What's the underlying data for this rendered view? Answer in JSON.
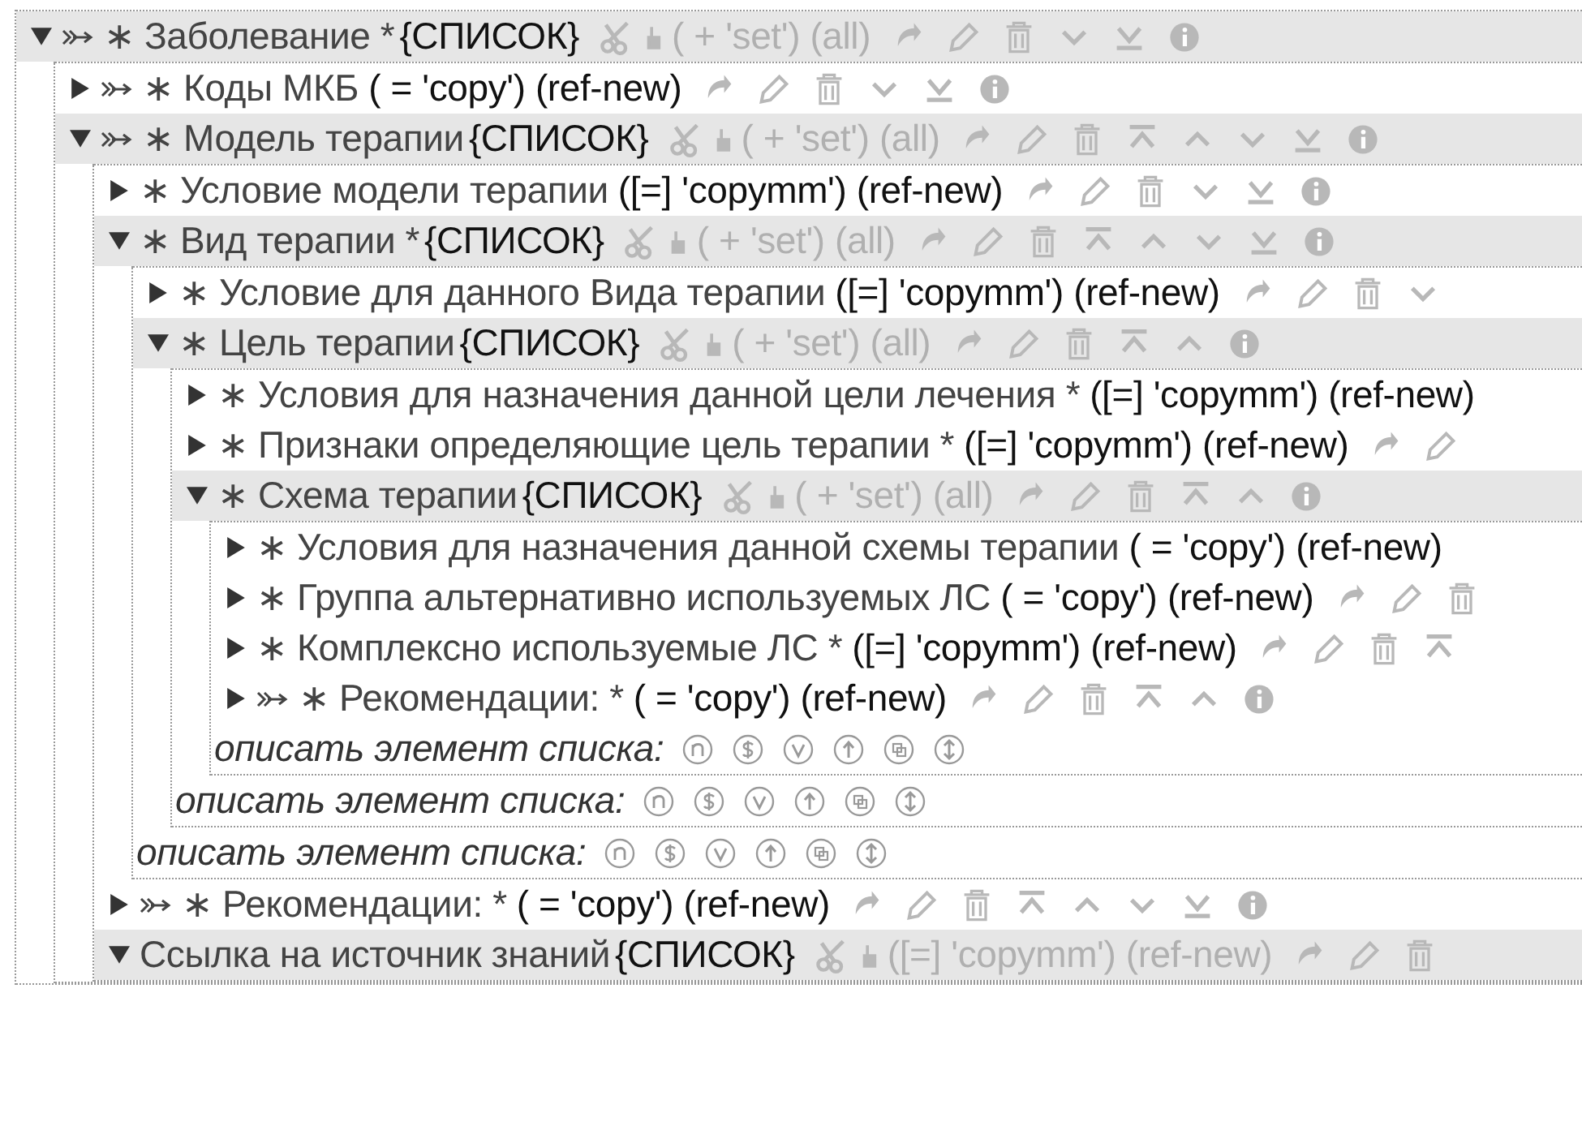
{
  "tree": {
    "label": "∗ Заболевание *",
    "link": true,
    "kind": "list",
    "tag": "{СПИСОК}",
    "extra": "( + 'set') (all)",
    "actions": [
      {
        "kind": "redo"
      },
      {
        "kind": "edit"
      },
      {
        "kind": "delete"
      },
      {
        "kind": "down"
      },
      {
        "kind": "bottom"
      },
      {
        "kind": "info"
      }
    ],
    "expanded": true,
    "children": [
      {
        "label": "∗ Коды МКБ",
        "link": true,
        "kind": "ref",
        "extra": "( = 'copy') (ref-new)",
        "actions": [
          {
            "kind": "redo"
          },
          {
            "kind": "edit"
          },
          {
            "kind": "delete"
          },
          {
            "kind": "down"
          },
          {
            "kind": "bottom"
          },
          {
            "kind": "info"
          }
        ],
        "expanded": false
      },
      {
        "label": "∗ Модель терапии",
        "link": true,
        "kind": "list",
        "tag": "{СПИСОК}",
        "extra": "( + 'set') (all)",
        "actions": [
          {
            "kind": "redo"
          },
          {
            "kind": "edit"
          },
          {
            "kind": "delete"
          },
          {
            "kind": "top"
          },
          {
            "kind": "up"
          },
          {
            "kind": "down"
          },
          {
            "kind": "bottom"
          },
          {
            "kind": "info"
          }
        ],
        "expanded": true,
        "children": [
          {
            "label": "∗ Условие модели терапии",
            "link": false,
            "kind": "ref",
            "extra": "([=] 'copymm') (ref-new)",
            "actions": [
              {
                "kind": "redo"
              },
              {
                "kind": "edit"
              },
              {
                "kind": "delete"
              },
              {
                "kind": "down"
              },
              {
                "kind": "bottom"
              },
              {
                "kind": "info"
              }
            ],
            "expanded": false
          },
          {
            "label": "∗ Вид терапии *",
            "link": false,
            "kind": "list",
            "tag": "{СПИСОК}",
            "extra": "( + 'set') (all)",
            "actions": [
              {
                "kind": "redo"
              },
              {
                "kind": "edit"
              },
              {
                "kind": "delete"
              },
              {
                "kind": "top"
              },
              {
                "kind": "up"
              },
              {
                "kind": "down"
              },
              {
                "kind": "bottom"
              },
              {
                "kind": "info"
              }
            ],
            "expanded": true,
            "children": [
              {
                "label": "∗ Условие для данного Вида терапии",
                "link": false,
                "kind": "ref",
                "extra": "([=] 'copymm') (ref-new)",
                "actions": [
                  {
                    "kind": "redo"
                  },
                  {
                    "kind": "edit"
                  },
                  {
                    "kind": "delete"
                  },
                  {
                    "kind": "down"
                  }
                ],
                "expanded": false
              },
              {
                "label": "∗ Цель терапии",
                "link": false,
                "kind": "list",
                "tag": "{СПИСОК}",
                "extra": "( + 'set') (all)",
                "actions": [
                  {
                    "kind": "redo"
                  },
                  {
                    "kind": "edit"
                  },
                  {
                    "kind": "delete"
                  },
                  {
                    "kind": "top"
                  },
                  {
                    "kind": "up"
                  },
                  {
                    "kind": "info"
                  }
                ],
                "expanded": true,
                "children": [
                  {
                    "label": "∗ Условия для назначения данной цели лечения *",
                    "link": false,
                    "kind": "ref",
                    "extra": "([=] 'copymm') (ref-new)",
                    "expanded": false
                  },
                  {
                    "label": "∗ Признаки определяющие цель терапии *",
                    "link": false,
                    "kind": "ref",
                    "extra": "([=] 'copymm') (ref-new)",
                    "actions": [
                      {
                        "kind": "redo"
                      },
                      {
                        "kind": "edit"
                      }
                    ],
                    "expanded": false
                  },
                  {
                    "label": "∗ Схема терапии",
                    "link": false,
                    "kind": "list",
                    "tag": "{СПИСОК}",
                    "extra": "( + 'set') (all)",
                    "actions": [
                      {
                        "kind": "redo"
                      },
                      {
                        "kind": "edit"
                      },
                      {
                        "kind": "delete"
                      },
                      {
                        "kind": "top"
                      },
                      {
                        "kind": "up"
                      },
                      {
                        "kind": "info"
                      }
                    ],
                    "expanded": true,
                    "children": [
                      {
                        "label": "∗ Условия для назначения данной схемы терапии",
                        "link": false,
                        "kind": "ref",
                        "extra": "( = 'copy') (ref-new)",
                        "expanded": false
                      },
                      {
                        "label": "∗ Группа альтернативно используемых ЛС",
                        "link": false,
                        "kind": "ref",
                        "extra": "( = 'copy') (ref-new)",
                        "actions": [
                          {
                            "kind": "redo"
                          },
                          {
                            "kind": "edit"
                          },
                          {
                            "kind": "delete"
                          }
                        ],
                        "expanded": false
                      },
                      {
                        "label": "∗ Комплексно используемые ЛС *",
                        "link": false,
                        "kind": "ref",
                        "extra": "([=] 'copymm') (ref-new)",
                        "actions": [
                          {
                            "kind": "redo"
                          },
                          {
                            "kind": "edit"
                          },
                          {
                            "kind": "delete"
                          },
                          {
                            "kind": "top"
                          }
                        ],
                        "expanded": false
                      },
                      {
                        "label": "∗ Рекомендации: *",
                        "link": true,
                        "kind": "ref",
                        "extra": "( = 'copy') (ref-new)",
                        "actions": [
                          {
                            "kind": "redo"
                          },
                          {
                            "kind": "edit"
                          },
                          {
                            "kind": "delete"
                          },
                          {
                            "kind": "top"
                          },
                          {
                            "kind": "up"
                          },
                          {
                            "kind": "info"
                          }
                        ],
                        "expanded": false
                      }
                    ],
                    "describe": {
                      "label": "описать элемент списка:",
                      "icons": [
                        {
                          "kind": "n"
                        },
                        {
                          "kind": "s"
                        },
                        {
                          "kind": "v"
                        },
                        {
                          "kind": "up"
                        },
                        {
                          "kind": "copy"
                        },
                        {
                          "kind": "updown"
                        }
                      ]
                    }
                  }
                ],
                "describe": {
                  "label": "описать элемент списка:",
                  "icons": [
                    {
                      "kind": "n"
                    },
                    {
                      "kind": "s"
                    },
                    {
                      "kind": "v"
                    },
                    {
                      "kind": "up"
                    },
                    {
                      "kind": "copy"
                    },
                    {
                      "kind": "updown"
                    }
                  ]
                }
              }
            ],
            "describe": {
              "label": "описать элемент списка:",
              "icons": [
                {
                  "kind": "n"
                },
                {
                  "kind": "s"
                },
                {
                  "kind": "v"
                },
                {
                  "kind": "up"
                },
                {
                  "kind": "copy"
                },
                {
                  "kind": "updown"
                }
              ]
            }
          },
          {
            "label": "∗ Рекомендации: *",
            "link": true,
            "kind": "ref",
            "extra": "( = 'copy') (ref-new)",
            "actions": [
              {
                "kind": "redo"
              },
              {
                "kind": "edit"
              },
              {
                "kind": "delete"
              },
              {
                "kind": "top"
              },
              {
                "kind": "up"
              },
              {
                "kind": "down"
              },
              {
                "kind": "bottom"
              },
              {
                "kind": "info"
              }
            ],
            "expanded": false
          },
          {
            "label": "Ссылка на источник знаний",
            "link": false,
            "kind": "list",
            "tag": "{СПИСОК}",
            "extra": "([=] 'copymm') (ref-new)",
            "actions": [
              {
                "kind": "redo"
              },
              {
                "kind": "edit"
              },
              {
                "kind": "delete"
              }
            ],
            "expanded": true
          }
        ]
      }
    ]
  }
}
